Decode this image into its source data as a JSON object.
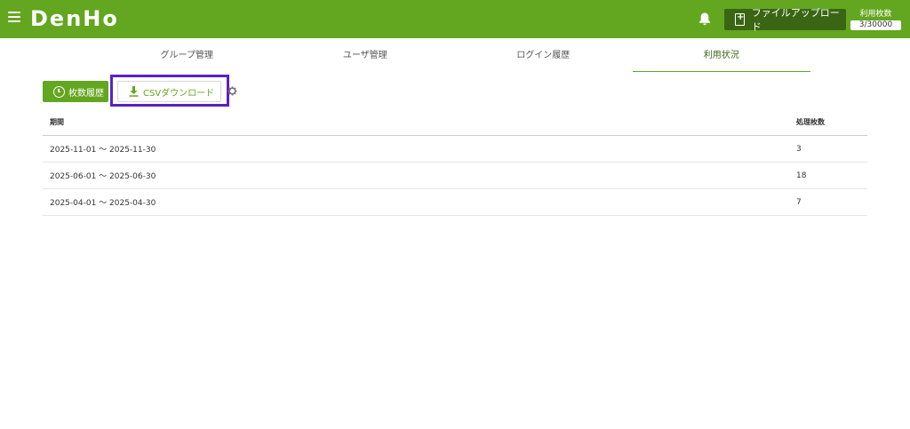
{
  "header": {
    "logo": "DenHo",
    "upload_label": "ファイルアップロード",
    "usage_label": "利用枚数",
    "usage_count": "3/30000"
  },
  "tabs": [
    {
      "label": "グループ管理"
    },
    {
      "label": "ユーザ管理"
    },
    {
      "label": "ログイン履歴"
    },
    {
      "label": "利用状況",
      "active": true
    }
  ],
  "toolbar": {
    "history_label": "枚数履歴",
    "csv_label": "CSVダウンロード"
  },
  "table": {
    "headers": {
      "period": "期間",
      "count": "処理枚数"
    },
    "rows": [
      {
        "period": "2025-11-01 〜 2025-11-30",
        "count": "3"
      },
      {
        "period": "2025-06-01 〜 2025-06-30",
        "count": "18"
      },
      {
        "period": "2025-04-01 〜 2025-04-30",
        "count": "7"
      }
    ]
  },
  "colors": {
    "brand_green": "#63a61f",
    "dark_green": "#3a6614",
    "highlight": "#5722c4"
  },
  "icons": [
    "menu-icon",
    "bell-icon",
    "file-upload-icon",
    "history-icon",
    "download-icon",
    "gear-icon"
  ]
}
